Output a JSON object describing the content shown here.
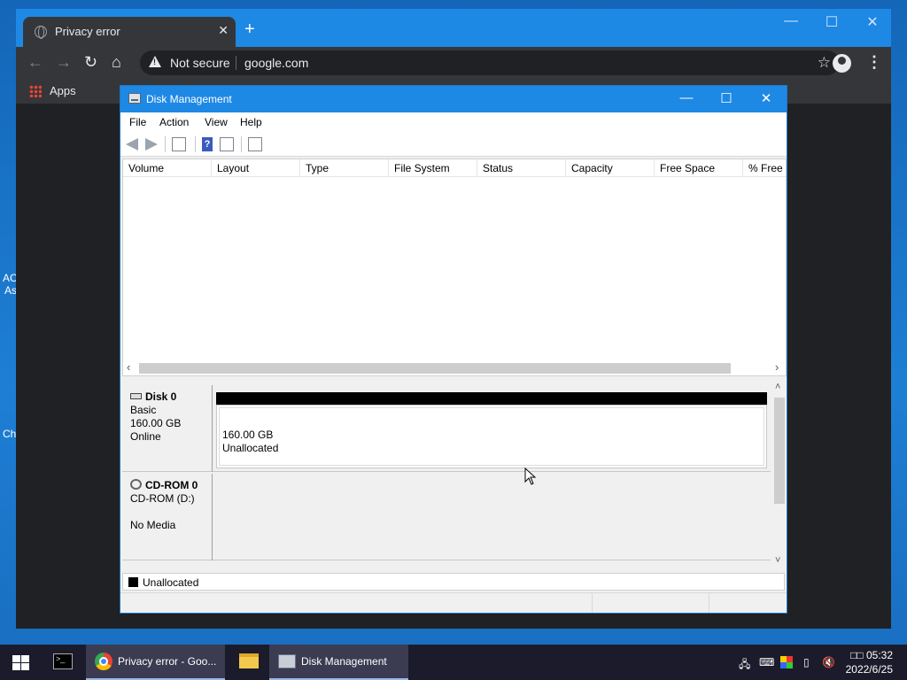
{
  "desktop": {
    "labels": [
      "AC",
      "As",
      "Ch"
    ]
  },
  "browser": {
    "tab_title": "Privacy error",
    "tab_close": "✕",
    "new_tab": "+",
    "minimize": "—",
    "maximize": "☐",
    "close": "✕",
    "security_label": "Not secure",
    "url": "google.com",
    "bookmarks": {
      "apps_label": "Apps"
    }
  },
  "disk_management": {
    "title": "Disk Management",
    "menu": [
      "File",
      "Action",
      "View",
      "Help"
    ],
    "columns": [
      "Volume",
      "Layout",
      "Type",
      "File System",
      "Status",
      "Capacity",
      "Free Space",
      "% Free"
    ],
    "disks": [
      {
        "name": "Disk 0",
        "line2": "Basic",
        "line3": "160.00 GB",
        "line4": "Online",
        "partition_size": "160.00 GB",
        "partition_status": "Unallocated"
      },
      {
        "name": "CD-ROM 0",
        "line2": "CD-ROM (D:)",
        "line3": "",
        "line4": "No Media"
      }
    ],
    "legend": {
      "label": "Unallocated",
      "color": "#000000"
    }
  },
  "taskbar": {
    "items": [
      "Privacy error - Goo...",
      "Disk Management"
    ],
    "time": "□□ 05:32",
    "date": "2022/6/25"
  },
  "colors": {
    "accent": "#1e88e5",
    "chrome_dark": "#35363a"
  }
}
